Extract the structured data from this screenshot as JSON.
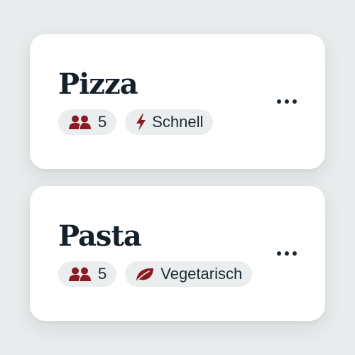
{
  "colors": {
    "background": "#e8ecec",
    "card": "#ffffff",
    "title": "#15202b",
    "pill_background": "#eaeeee",
    "icon_accent": "#8b1a22"
  },
  "recipes": [
    {
      "title": "Pizza",
      "servings": "5",
      "servings_icon": "people-icon",
      "tag_label": "Schnell",
      "tag_icon": "lightning-icon",
      "menu_icon": "more-options-icon"
    },
    {
      "title": "Pasta",
      "servings": "5",
      "servings_icon": "people-icon",
      "tag_label": "Vegetarisch",
      "tag_icon": "leaf-icon",
      "menu_icon": "more-options-icon"
    }
  ]
}
